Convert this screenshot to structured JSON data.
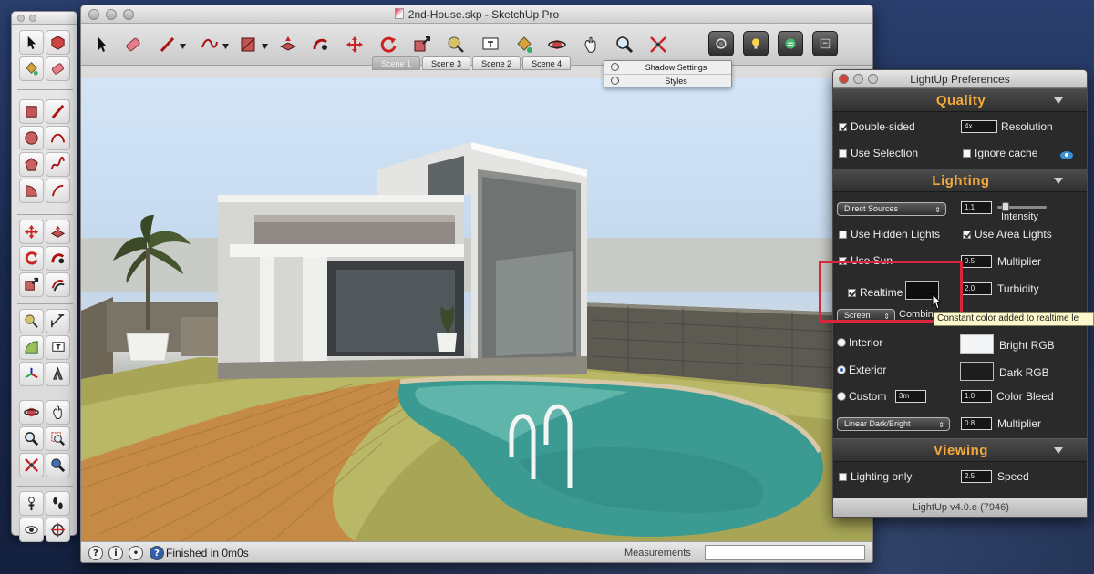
{
  "app": {
    "window_title": "2nd-House.skp - SketchUp Pro"
  },
  "scenes": {
    "tabs": [
      "Scene 1",
      "Scene 3",
      "Scene 2",
      "Scene 4"
    ],
    "active_tab": "Scene 1",
    "menu": {
      "items": [
        "Shadow Settings",
        "Styles"
      ]
    }
  },
  "toolbar": {
    "icons": [
      "select-arrow",
      "eraser",
      "pencil",
      "freehand",
      "rectangle",
      "push-pull",
      "follow-me",
      "move",
      "rotate",
      "scale",
      "tape-measure",
      "text",
      "paint-bucket",
      "orbit",
      "pan",
      "zoom",
      "zoom-extents",
      "lightup-render",
      "lightup-bulb",
      "lightup-refresh",
      "lightup-export"
    ]
  },
  "palette": {
    "icons": [
      "select",
      "make-component",
      "paint-bucket",
      "eraser",
      "rectangle",
      "line",
      "circle",
      "arc",
      "polygon",
      "freehand",
      "move",
      "push-pull",
      "rotate",
      "follow-me",
      "scale",
      "offset",
      "tape-measure",
      "text",
      "axes",
      "dimension",
      "protractor",
      "3d-text",
      "orbit",
      "pan",
      "zoom",
      "zoom-window",
      "zoom-extents",
      "previous-view",
      "position-camera",
      "walk",
      "look-around",
      "section-plane"
    ]
  },
  "status": {
    "message": "Finished in 0m0s",
    "measurements_label": "Measurements",
    "measurements_value": ""
  },
  "lightup": {
    "title": "LightUp Preferences",
    "footer": "LightUp v4.0.e (7946)",
    "quality": {
      "title": "Quality",
      "double_sided": "Double-sided",
      "resolution_value": "4x",
      "resolution_label": "Resolution",
      "use_selection": "Use Selection",
      "ignore_cache": "Ignore cache"
    },
    "lighting": {
      "title": "Lighting",
      "source_select": "Direct Sources",
      "intensity_value": "1.1",
      "intensity_label": "Intensity",
      "use_hidden_lights": "Use Hidden Lights",
      "use_area_lights": "Use Area Lights",
      "use_sun": "Use Sun",
      "multiplier_value": "0.5",
      "multiplier_label": "Multiplier",
      "realtime": "Realtime",
      "turbidity_value": "2.0",
      "turbidity_label": "Turbidity",
      "screen_select": "Screen",
      "combine_label": "Combin",
      "interior": "Interior",
      "bright_rgb": "Bright RGB",
      "exterior": "Exterior",
      "dark_rgb": "Dark RGB",
      "custom": "Custom",
      "custom_value": "3m",
      "color_bleed_value": "1.0",
      "color_bleed_label": "Color Bleed",
      "tone_select": "Linear Dark/Bright",
      "tone_multiplier_value": "0.8",
      "tone_multiplier_label": "Multiplier",
      "tooltip": "Constant color added to realtime le"
    },
    "viewing": {
      "title": "Viewing",
      "lighting_only": "Lighting only",
      "speed_value": "2.5",
      "speed_label": "Speed"
    },
    "colors": {
      "accent": "#f3a93c",
      "bright_swatch": "#f3f5f6",
      "dark_swatch": "#1d1d1d",
      "realtime_swatch": "#0e0e0e",
      "highlight": "#d9263c"
    }
  }
}
